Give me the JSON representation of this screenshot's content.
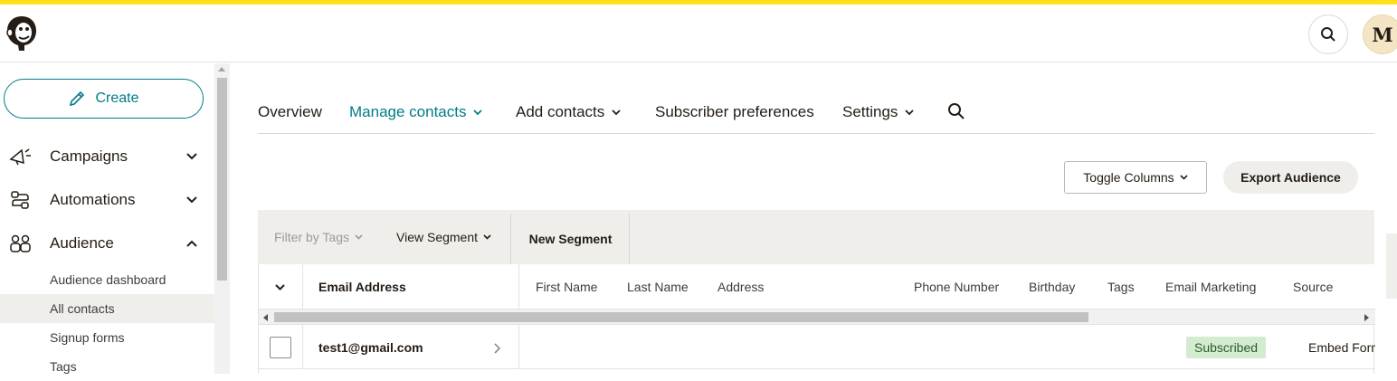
{
  "header": {
    "logo": "mailchimp-freddie-logo",
    "search_icon": "search-icon",
    "avatar_initial": "M"
  },
  "sidebar": {
    "create_label": "Create",
    "items": [
      {
        "label": "Campaigns",
        "icon": "megaphone-icon",
        "expanded": false
      },
      {
        "label": "Automations",
        "icon": "flow-icon",
        "expanded": false
      },
      {
        "label": "Audience",
        "icon": "audience-icon",
        "expanded": true
      }
    ],
    "sub_items": [
      {
        "label": "Audience dashboard",
        "active": false
      },
      {
        "label": "All contacts",
        "active": true
      },
      {
        "label": "Signup forms",
        "active": false
      },
      {
        "label": "Tags",
        "active": false
      }
    ]
  },
  "tabs": [
    {
      "label": "Overview",
      "dropdown": false,
      "active": false
    },
    {
      "label": "Manage contacts",
      "dropdown": true,
      "active": true
    },
    {
      "label": "Add contacts",
      "dropdown": true,
      "active": false
    },
    {
      "label": "Subscriber preferences",
      "dropdown": false,
      "active": false
    },
    {
      "label": "Settings",
      "dropdown": true,
      "active": false
    }
  ],
  "toolbar": {
    "toggle_columns": "Toggle Columns",
    "export_audience": "Export Audience"
  },
  "filters": {
    "filter_by_tags": "Filter by Tags",
    "view_segment": "View Segment",
    "new_segment": "New Segment"
  },
  "table": {
    "columns": [
      "Email Address",
      "First Name",
      "Last Name",
      "Address",
      "Phone Number",
      "Birthday",
      "Tags",
      "Email Marketing",
      "Source"
    ],
    "rows": [
      {
        "email": "test1@gmail.com",
        "first_name": "",
        "last_name": "",
        "address": "",
        "phone": "",
        "birthday": "",
        "tags": "",
        "email_marketing": "Subscribed",
        "source": "Embed Form"
      }
    ]
  },
  "colors": {
    "accent": "#007c89",
    "brand_yellow": "#ffe01b",
    "subscribed_badge": "#d3ecd0"
  }
}
